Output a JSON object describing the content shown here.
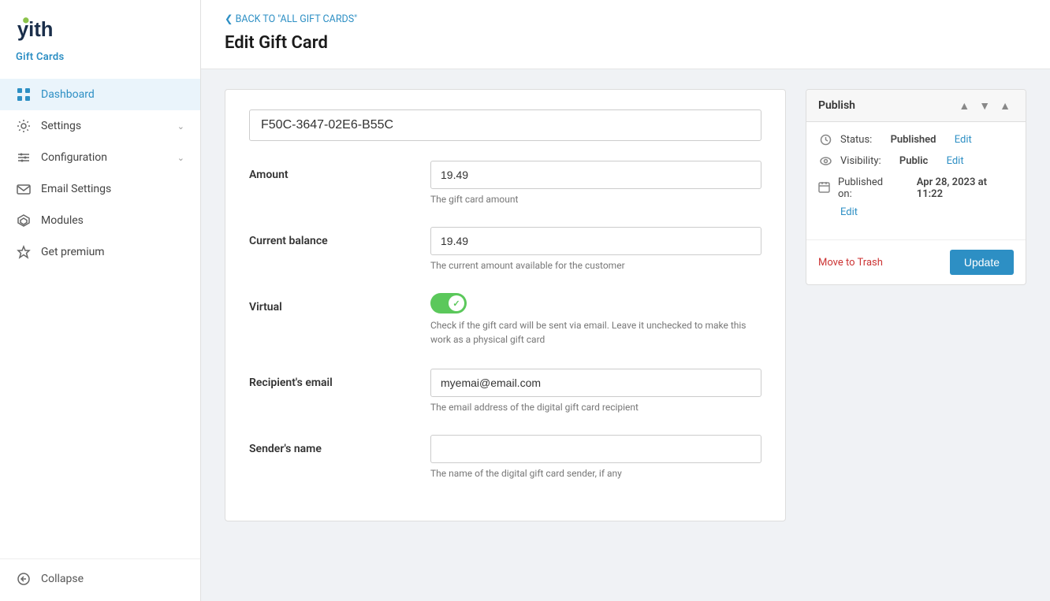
{
  "brand": {
    "name": "Gift Cards",
    "logo_alt": "YITH logo"
  },
  "sidebar": {
    "items": [
      {
        "id": "dashboard",
        "label": "Dashboard",
        "icon": "dashboard-icon",
        "active": true,
        "hasChevron": false
      },
      {
        "id": "settings",
        "label": "Settings",
        "icon": "settings-icon",
        "active": false,
        "hasChevron": true
      },
      {
        "id": "configuration",
        "label": "Configuration",
        "icon": "configuration-icon",
        "active": false,
        "hasChevron": true
      },
      {
        "id": "email-settings",
        "label": "Email Settings",
        "icon": "email-icon",
        "active": false,
        "hasChevron": false
      },
      {
        "id": "modules",
        "label": "Modules",
        "icon": "modules-icon",
        "active": false,
        "hasChevron": false
      },
      {
        "id": "get-premium",
        "label": "Get premium",
        "icon": "premium-icon",
        "active": false,
        "hasChevron": false
      }
    ],
    "collapse_label": "Collapse"
  },
  "header": {
    "back_link": "BACK TO \"ALL GIFT CARDS\"",
    "page_title": "Edit Gift Card"
  },
  "form": {
    "gift_card_code": "F50C-3647-02E6-B55C",
    "amount_label": "Amount",
    "amount_value": "19.49",
    "amount_hint": "The gift card amount",
    "current_balance_label": "Current balance",
    "current_balance_value": "19.49",
    "current_balance_hint": "The current amount available for the customer",
    "virtual_label": "Virtual",
    "virtual_checked": true,
    "virtual_hint": "Check if the gift card will be sent via email. Leave it unchecked to make this work as a physical gift card",
    "recipient_email_label": "Recipient's email",
    "recipient_email_value": "myemai@email.com",
    "recipient_email_hint": "The email address of the digital gift card recipient",
    "sender_name_label": "Sender's name",
    "sender_name_value": "",
    "sender_name_hint": "The name of the digital gift card sender, if any"
  },
  "publish": {
    "panel_title": "Publish",
    "status_label": "Status:",
    "status_value": "Published",
    "status_edit": "Edit",
    "visibility_label": "Visibility:",
    "visibility_value": "Public",
    "visibility_edit": "Edit",
    "published_on_label": "Published on:",
    "published_on_date": "Apr 28, 2023 at 11:22",
    "published_on_edit": "Edit",
    "move_to_trash": "Move to Trash",
    "update_button": "Update"
  }
}
